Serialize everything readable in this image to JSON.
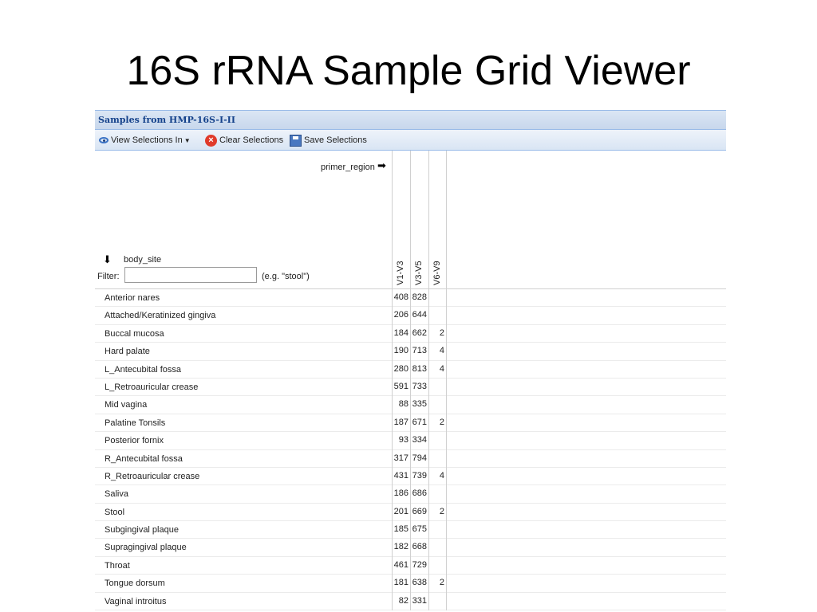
{
  "slide": {
    "title": "16S rRNA Sample Grid Viewer"
  },
  "panel": {
    "title": "Samples from HMP-16S-I-II"
  },
  "toolbar": {
    "view_label": "View Selections In",
    "clear_label": "Clear Selections",
    "save_label": "Save Selections"
  },
  "grid": {
    "column_field": "primer_region",
    "row_field": "body_site",
    "filter_label": "Filter:",
    "filter_value": "",
    "filter_hint": "(e.g. \"stool\")",
    "columns": [
      "V1-V3",
      "V3-V5",
      "V6-V9"
    ],
    "rows": [
      {
        "name": "Anterior nares",
        "values": [
          "408",
          "828",
          ""
        ]
      },
      {
        "name": "Attached/Keratinized gingiva",
        "values": [
          "206",
          "644",
          ""
        ]
      },
      {
        "name": "Buccal mucosa",
        "values": [
          "184",
          "662",
          "2"
        ]
      },
      {
        "name": "Hard palate",
        "values": [
          "190",
          "713",
          "4"
        ]
      },
      {
        "name": "L_Antecubital fossa",
        "values": [
          "280",
          "813",
          "4"
        ]
      },
      {
        "name": "L_Retroauricular crease",
        "values": [
          "591",
          "733",
          ""
        ]
      },
      {
        "name": "Mid vagina",
        "values": [
          "88",
          "335",
          ""
        ]
      },
      {
        "name": "Palatine Tonsils",
        "values": [
          "187",
          "671",
          "2"
        ]
      },
      {
        "name": "Posterior fornix",
        "values": [
          "93",
          "334",
          ""
        ]
      },
      {
        "name": "R_Antecubital fossa",
        "values": [
          "317",
          "794",
          ""
        ]
      },
      {
        "name": "R_Retroauricular crease",
        "values": [
          "431",
          "739",
          "4"
        ]
      },
      {
        "name": "Saliva",
        "values": [
          "186",
          "686",
          ""
        ]
      },
      {
        "name": "Stool",
        "values": [
          "201",
          "669",
          "2"
        ]
      },
      {
        "name": "Subgingival plaque",
        "values": [
          "185",
          "675",
          ""
        ]
      },
      {
        "name": "Supragingival plaque",
        "values": [
          "182",
          "668",
          ""
        ]
      },
      {
        "name": "Throat",
        "values": [
          "461",
          "729",
          ""
        ]
      },
      {
        "name": "Tongue dorsum",
        "values": [
          "181",
          "638",
          "2"
        ]
      },
      {
        "name": "Vaginal introitus",
        "values": [
          "82",
          "331",
          ""
        ]
      }
    ]
  }
}
